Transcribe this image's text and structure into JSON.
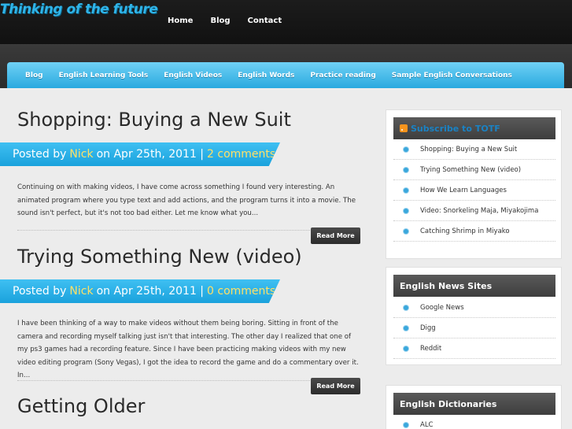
{
  "header": {
    "logo": "Thinking of the future",
    "nav": [
      "Home",
      "Blog",
      "Contact"
    ]
  },
  "categories": [
    "Blog",
    "English Learning Tools",
    "English Videos",
    "English Words",
    "Practice reading",
    "Sample English Conversations"
  ],
  "posts": [
    {
      "title": "Shopping: Buying a New Suit",
      "posted_by": "Posted by",
      "author": "Nick",
      "date": "on Apr 25th, 2011 |",
      "comments": "2 comments",
      "excerpt": "Continuing on with making videos, I have come across something I found very interesting. An animated program where you type text and add actions, and the program turns it into a movie. The sound isn't perfect, but it's not too bad either. Let me know what you...",
      "read_more": "Read More"
    },
    {
      "title": "Trying Something New (video)",
      "posted_by": "Posted by",
      "author": "Nick",
      "date": "on Apr 25th, 2011 |",
      "comments": "0 comments",
      "excerpt": "I have been thinking of a way to make videos without them being boring. Sitting in front of the camera and recording myself talking just isn't that interesting. The other day I realized that one of my ps3 games had a recording feature. Since I have been practicing making videos with my new video editing program (Sony Vegas), I got the idea to record the game and do a commentary over it. In...",
      "read_more": "Read More"
    },
    {
      "title": "Getting Older"
    }
  ],
  "sidebar": {
    "subscribe": {
      "prefix": "Subscribe to",
      "name": "TOTF",
      "items": [
        "Shopping: Buying a New Suit",
        "Trying Something New (video)",
        "How We Learn Languages",
        "Video: Snorkeling Maja, Miyakojima",
        "Catching Shrimp in Miyako"
      ]
    },
    "news": {
      "title": "English News Sites",
      "items": [
        "Google News",
        "Digg",
        "Reddit"
      ]
    },
    "dictionaries": {
      "title": "English Dictionaries",
      "items": [
        "ALC"
      ]
    }
  },
  "colors": {
    "accent": "#2aa9df",
    "highlight": "#ffe066",
    "rss": "#f7941d"
  }
}
